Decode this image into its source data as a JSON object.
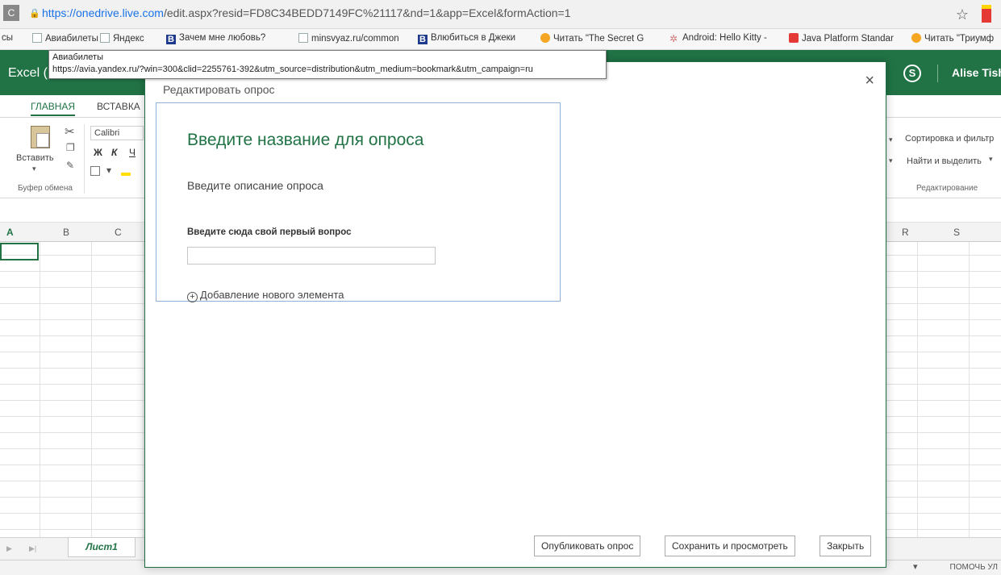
{
  "browser": {
    "url_host": "https://onedrive.live.com",
    "url_path": "/edit.aspx?resid=FD8C34BEDD7149FC%21117&nd=1&app=Excel&formAction=1",
    "bookmarks": [
      {
        "label": "сы",
        "icon": "none"
      },
      {
        "label": "Авиабилеты",
        "icon": "page-icon"
      },
      {
        "label": "Яндекс",
        "icon": "page-icon"
      },
      {
        "label": "Зачем мне любовь?",
        "icon": "b-icon"
      },
      {
        "label": "minsvyaz.ru/common",
        "icon": "page-icon"
      },
      {
        "label": "Влюбиться в Джеки",
        "icon": "b-icon"
      },
      {
        "label": "Читать \"The Secret G",
        "icon": "circle-icon"
      },
      {
        "label": "Android: Hello Kitty -",
        "icon": "android-icon"
      },
      {
        "label": "Java Platform Standar",
        "icon": "red-icon"
      },
      {
        "label": "Читать \"Триумф",
        "icon": "circle-icon"
      }
    ],
    "tooltip": {
      "title": "Авиабилеты",
      "url": "https://avia.yandex.ru/?win=300&clid=2255761-392&utm_source=distribution&utm_medium=bookmark&utm_campaign=ru"
    }
  },
  "excel": {
    "brand": "Excel (",
    "user": "Alise Tishi",
    "tabs": [
      "ГЛАВНАЯ",
      "ВСТАВКА"
    ],
    "ribbon": {
      "paste": "Вставить",
      "clipboard_group": "Буфер обмена",
      "font": "Calibri",
      "bold": "Ж",
      "italic": "К",
      "underline": "Ч",
      "sort_filter": "Сортировка и фильтр",
      "find_select": "Найти и выделить",
      "editing_group": "Редактирование"
    },
    "columns_left": [
      "A",
      "B",
      "C"
    ],
    "columns_right": [
      "R",
      "S"
    ],
    "sheet": "Лист1",
    "status": "ПОМОЧЬ УЛ"
  },
  "dialog": {
    "title": "Редактировать опрос",
    "survey_title_placeholder": "Введите название для опроса",
    "survey_description_placeholder": "Введите описание опроса",
    "first_question_label": "Введите сюда свой первый вопрос",
    "add_element": "Добавление нового элемента",
    "buttons": {
      "publish": "Опубликовать опрос",
      "save_view": "Сохранить и просмотреть",
      "close": "Закрыть"
    }
  }
}
